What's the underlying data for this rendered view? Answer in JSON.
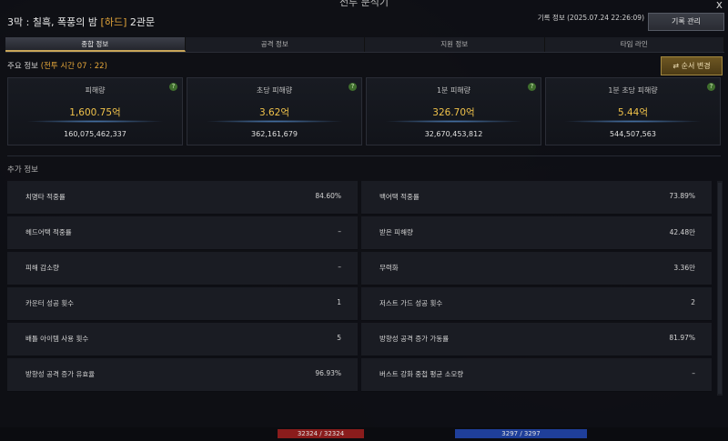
{
  "window": {
    "title": "전투 분석기",
    "close": "x"
  },
  "header": {
    "stage_prefix": "3막 : 칠흑, 폭풍의 밤 ",
    "difficulty": "[하드]",
    "stage_suffix": " 2관문",
    "record_info": "기록 정보 (2025.07.24 22:26:09)",
    "record_manage": "기록 관리"
  },
  "tabs": [
    "종합 정보",
    "공격 정보",
    "지원 정보",
    "타임 라인"
  ],
  "main": {
    "title_prefix": "주요 정보 ",
    "battle_time": "(전투 시간 07 : 22)",
    "order_button": "순서 변경"
  },
  "stats": [
    {
      "label": "피해량",
      "value": "1,600.75억",
      "raw": "160,075,462,337",
      "help": "?"
    },
    {
      "label": "초당 피해량",
      "value": "3.62억",
      "raw": "362,161,679",
      "help": "?"
    },
    {
      "label": "1분 피해량",
      "value": "326.70억",
      "raw": "32,670,453,812",
      "help": "?"
    },
    {
      "label": "1분 초당 피해량",
      "value": "5.44억",
      "raw": "544,507,563",
      "help": "?"
    }
  ],
  "extra": {
    "title": "추가 정보",
    "left": [
      {
        "k": "치명타 적중률",
        "v": "84.60%"
      },
      {
        "k": "헤드어택 적중률",
        "v": "–"
      },
      {
        "k": "피해 감소량",
        "v": "–"
      },
      {
        "k": "카운터 성공 횟수",
        "v": "1"
      },
      {
        "k": "배틀 아이템 사용 횟수",
        "v": "5"
      },
      {
        "k": "방향성 공격 증가 유효율",
        "v": "96.93%"
      }
    ],
    "right": [
      {
        "k": "백어택 적중률",
        "v": "73.89%"
      },
      {
        "k": "받은 피해량",
        "v": "42.48만"
      },
      {
        "k": "무력화",
        "v": "3.36만"
      },
      {
        "k": "저스트 가드 성공 횟수",
        "v": "2"
      },
      {
        "k": "방향성 공격 증가 가동률",
        "v": "81.97%"
      },
      {
        "k": "버스트 강화 중첩 평균 소모량",
        "v": "–"
      }
    ]
  },
  "bottom": {
    "hp_left": "32324 / 32324",
    "hp_right": "3297 / 3297"
  }
}
